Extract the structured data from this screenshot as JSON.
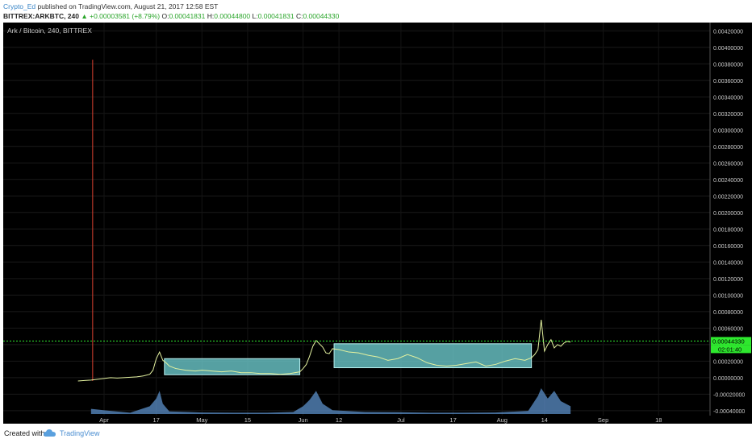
{
  "header": {
    "author": "Crypto_Ed",
    "published_text": "published on TradingView.com, August 21, 2017 12:58 EST",
    "ticker": "BITTREX:ARKBTC, 240",
    "change": "▲ +0.00003581 (+8.79%)",
    "ohlc": [
      {
        "label": "O:",
        "value": "0.00041831"
      },
      {
        "label": "H:",
        "value": "0.00044800"
      },
      {
        "label": "L:",
        "value": "0.00041831"
      },
      {
        "label": "C:",
        "value": "0.00044330"
      }
    ]
  },
  "chart_title": "Ark / Bitcoin, 240, BITTREX",
  "price_badge": "0.00044330",
  "time_badge": "02:01:40",
  "footer": {
    "created_with": "Created with",
    "brand": "TradingView"
  },
  "colors": {
    "background": "#000000",
    "price_line": "#e4f2a0",
    "box_fill": "#6ecdd0",
    "volume": "#5b8fc8",
    "current_price": "#2ee82e"
  },
  "chart_data": {
    "type": "line",
    "title": "Ark / Bitcoin, 240, BITTREX",
    "ylim": [
      -0.00046,
      0.0043
    ],
    "y_ticks": [
      "0.00420000",
      "0.00400000",
      "0.00380000",
      "0.00360000",
      "0.00340000",
      "0.00320000",
      "0.00300000",
      "0.00280000",
      "0.00260000",
      "0.00240000",
      "0.00220000",
      "0.00200000",
      "0.00180000",
      "0.00160000",
      "0.00140000",
      "0.00120000",
      "0.00100000",
      "0.00080000",
      "0.00060000",
      "0.00040000",
      "0.00020000",
      "0.00000000",
      "-0.00020000",
      "-0.00040000"
    ],
    "x_ticks": [
      {
        "label": "Apr",
        "day": 0
      },
      {
        "label": "17",
        "day": 16
      },
      {
        "label": "May",
        "day": 30
      },
      {
        "label": "15",
        "day": 44
      },
      {
        "label": "Jun",
        "day": 61
      },
      {
        "label": "12",
        "day": 72
      },
      {
        "label": "Jul",
        "day": 91
      },
      {
        "label": "17",
        "day": 107
      },
      {
        "label": "Aug",
        "day": 122
      },
      {
        "label": "14",
        "day": 135
      },
      {
        "label": "Sep",
        "day": 153
      },
      {
        "label": "18",
        "day": 170
      }
    ],
    "x_range_days": [
      -3.5,
      178.3
    ],
    "price_series": [
      [
        -8,
        -4e-05
      ],
      [
        -6,
        -3.5e-05
      ],
      [
        -4,
        -3e-05
      ],
      [
        -2,
        -2e-05
      ],
      [
        0,
        -1e-05
      ],
      [
        2,
        0
      ],
      [
        4,
        -5e-06
      ],
      [
        6,
        0
      ],
      [
        8,
        5e-06
      ],
      [
        10,
        1e-05
      ],
      [
        12,
        2e-05
      ],
      [
        14,
        4e-05
      ],
      [
        15,
        9e-05
      ],
      [
        16,
        0.00023
      ],
      [
        17,
        0.00031
      ],
      [
        18,
        0.00021
      ],
      [
        19,
        0.00018
      ],
      [
        20,
        0.00014
      ],
      [
        22,
        0.00011
      ],
      [
        25,
        9e-05
      ],
      [
        28,
        8e-05
      ],
      [
        30,
        9e-05
      ],
      [
        33,
        8e-05
      ],
      [
        36,
        7e-05
      ],
      [
        39,
        8e-05
      ],
      [
        42,
        6e-05
      ],
      [
        45,
        6e-05
      ],
      [
        48,
        5e-05
      ],
      [
        51,
        5e-05
      ],
      [
        54,
        4e-05
      ],
      [
        57,
        5e-05
      ],
      [
        60,
        7e-05
      ],
      [
        61,
        0.00011
      ],
      [
        62,
        0.00016
      ],
      [
        63,
        0.00026
      ],
      [
        64,
        0.00038
      ],
      [
        65,
        0.00045
      ],
      [
        66,
        0.00041
      ],
      [
        67,
        0.00037
      ],
      [
        68,
        0.0003
      ],
      [
        69,
        0.00029
      ],
      [
        70,
        0.00035
      ],
      [
        72,
        0.00034
      ],
      [
        75,
        0.00031
      ],
      [
        78,
        0.0003
      ],
      [
        81,
        0.00027
      ],
      [
        84,
        0.00025
      ],
      [
        87,
        0.00021
      ],
      [
        90,
        0.00023
      ],
      [
        93,
        0.00028
      ],
      [
        96,
        0.00024
      ],
      [
        99,
        0.00018
      ],
      [
        102,
        0.00015
      ],
      [
        105,
        0.00014
      ],
      [
        108,
        0.00015
      ],
      [
        111,
        0.00017
      ],
      [
        114,
        0.00019
      ],
      [
        117,
        0.00014
      ],
      [
        120,
        0.00016
      ],
      [
        123,
        0.0002
      ],
      [
        126,
        0.00023
      ],
      [
        129,
        0.00021
      ],
      [
        131,
        0.00024
      ],
      [
        132,
        0.00028
      ],
      [
        133,
        0.00034
      ],
      [
        134,
        0.0007
      ],
      [
        135,
        0.00032
      ],
      [
        136,
        0.0004
      ],
      [
        137,
        0.00046
      ],
      [
        138,
        0.00036
      ],
      [
        139,
        0.0004
      ],
      [
        140,
        0.00038
      ],
      [
        141,
        0.00042
      ],
      [
        142,
        0.00044
      ],
      [
        143,
        0.00043
      ]
    ],
    "boxes": [
      {
        "x0": 18.5,
        "x1": 60,
        "y0": 3.5e-05,
        "y1": 0.00023
      },
      {
        "x0": 70.5,
        "x1": 131,
        "y0": 0.00012,
        "y1": 0.00041
      }
    ],
    "spike_day": -3.5,
    "spike_top": 0.00385,
    "current_price": 0.0004433,
    "volume": [
      [
        -4,
        0.2
      ],
      [
        2,
        0.12
      ],
      [
        8,
        0.05
      ],
      [
        14,
        0.3
      ],
      [
        16,
        0.6
      ],
      [
        17,
        0.9
      ],
      [
        18,
        0.4
      ],
      [
        20,
        0.1
      ],
      [
        26,
        0.08
      ],
      [
        30,
        0.06
      ],
      [
        40,
        0.05
      ],
      [
        50,
        0.05
      ],
      [
        58,
        0.08
      ],
      [
        61,
        0.3
      ],
      [
        63,
        0.55
      ],
      [
        65,
        0.9
      ],
      [
        67,
        0.4
      ],
      [
        70,
        0.15
      ],
      [
        80,
        0.08
      ],
      [
        90,
        0.07
      ],
      [
        100,
        0.05
      ],
      [
        110,
        0.05
      ],
      [
        120,
        0.06
      ],
      [
        130,
        0.12
      ],
      [
        133,
        0.7
      ],
      [
        134,
        1.0
      ],
      [
        136,
        0.6
      ],
      [
        138,
        0.9
      ],
      [
        140,
        0.5
      ],
      [
        143,
        0.3
      ]
    ]
  }
}
